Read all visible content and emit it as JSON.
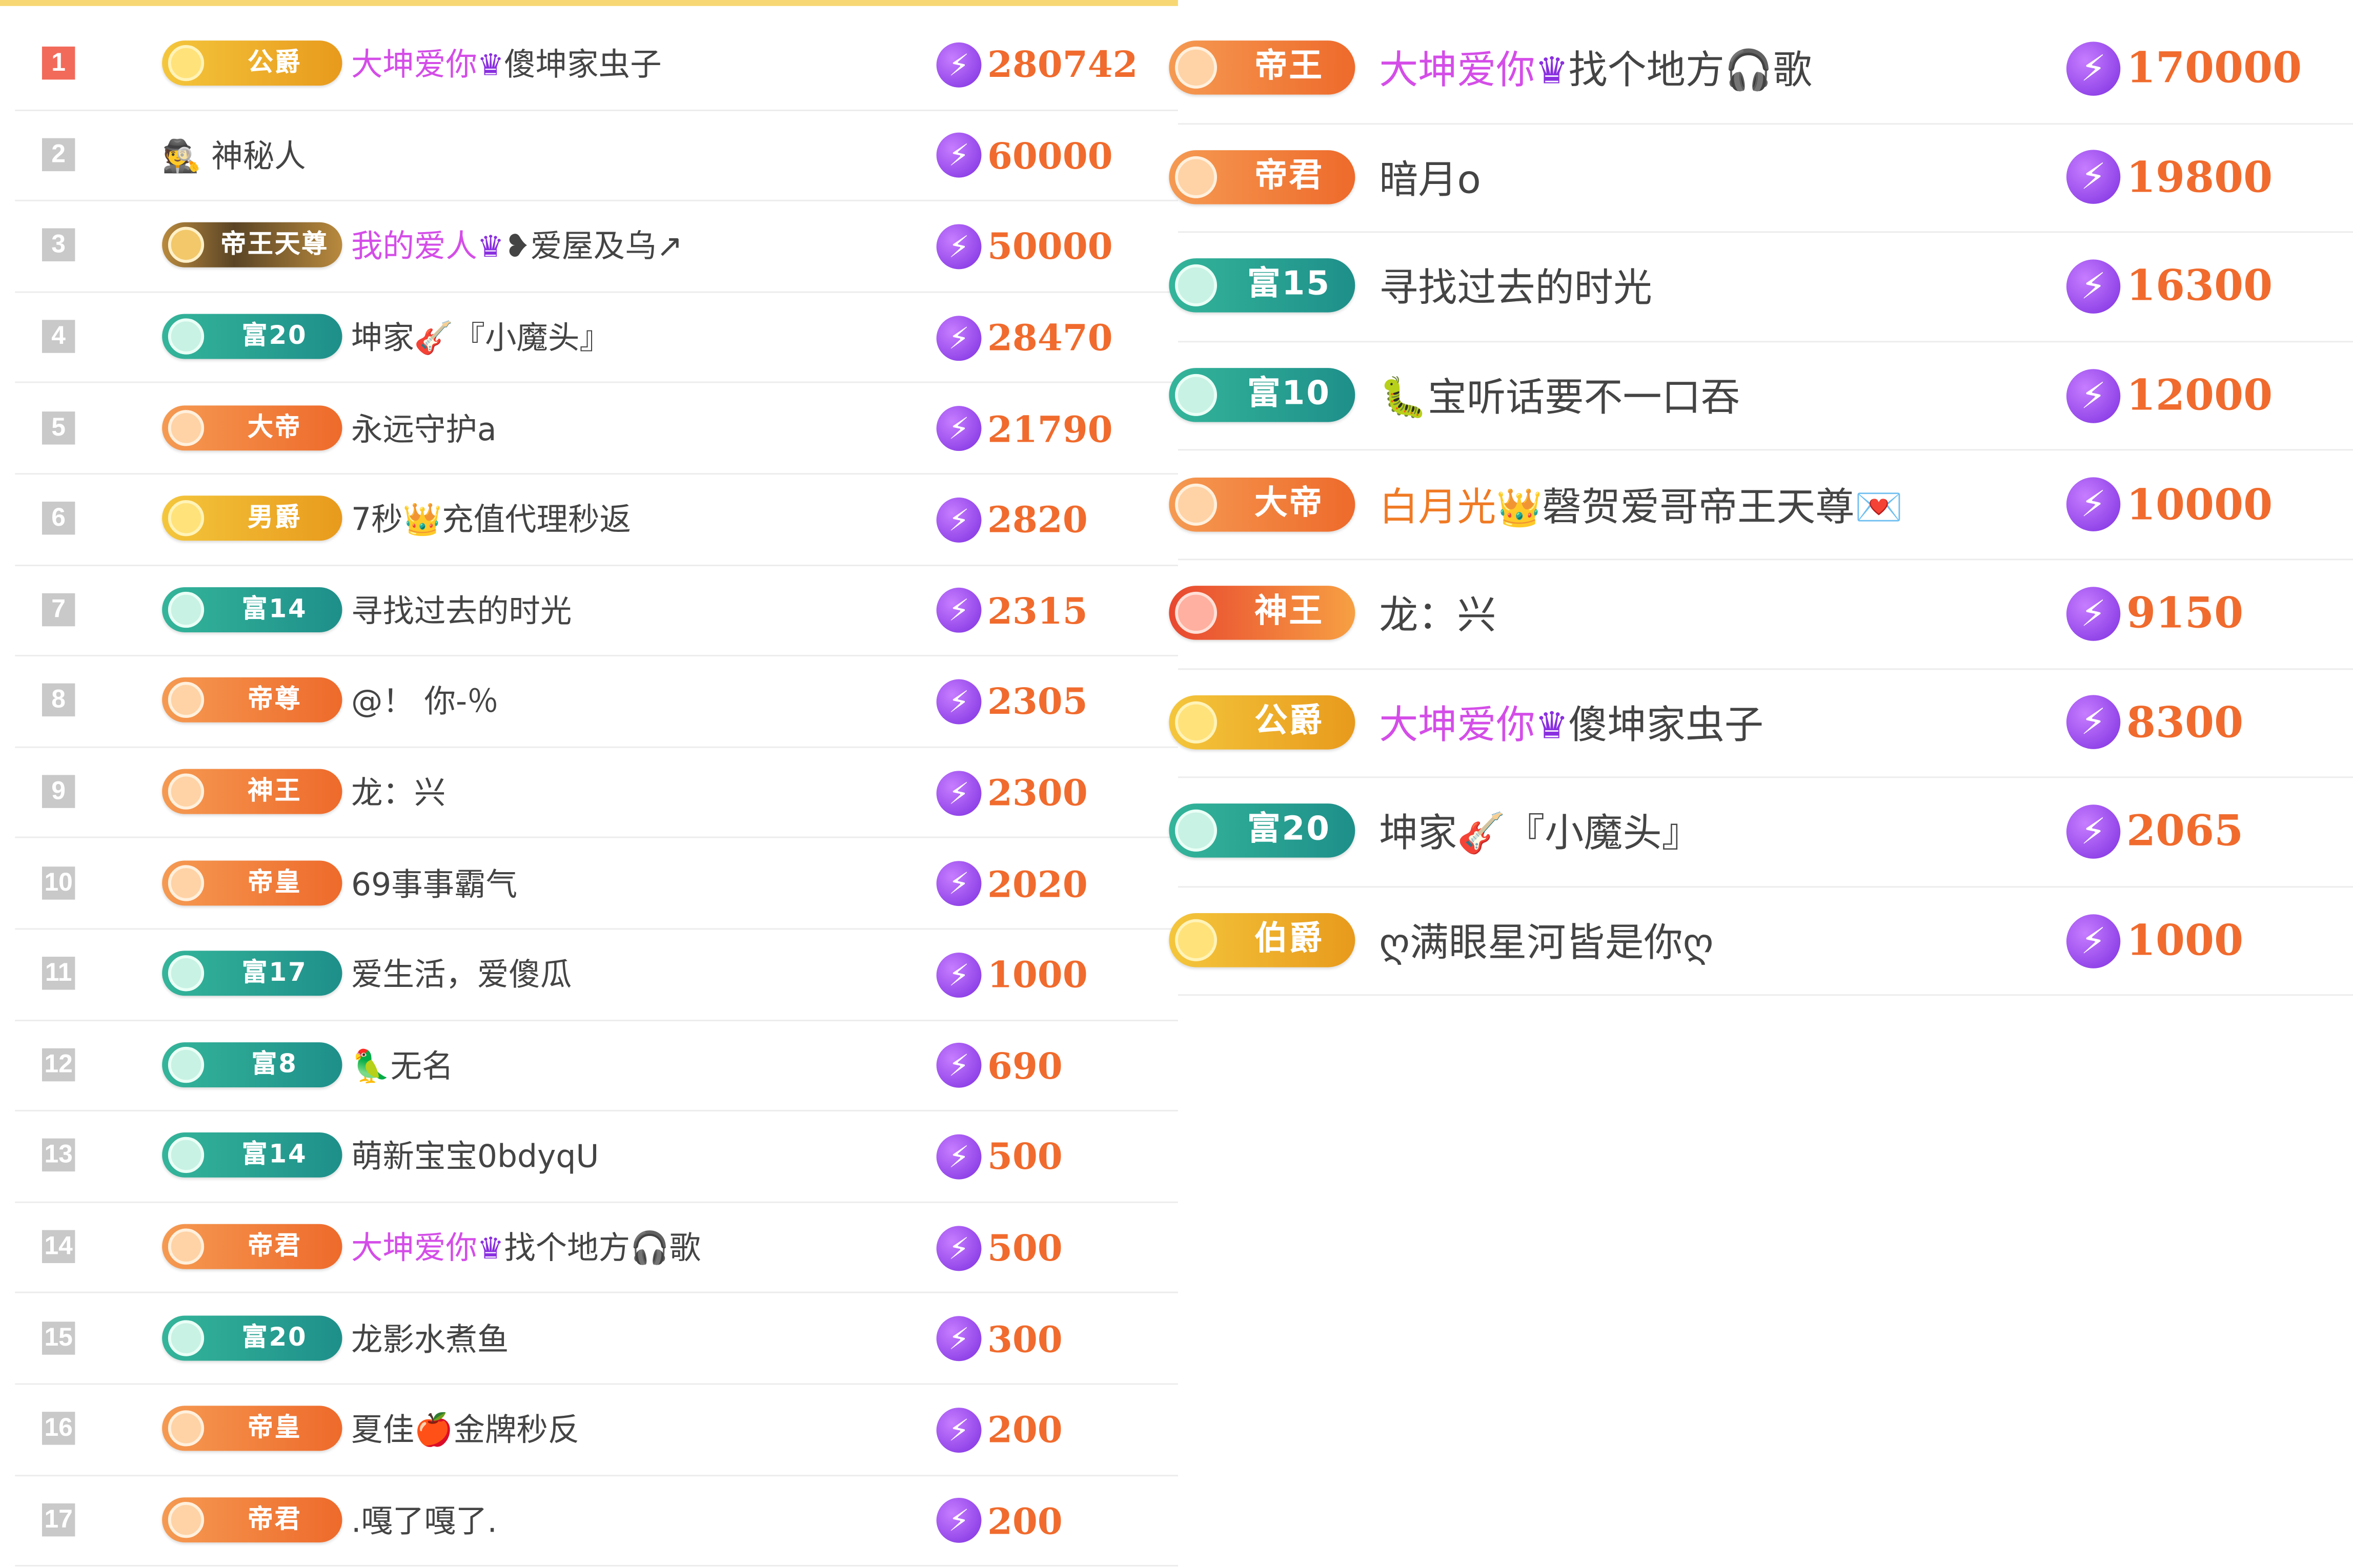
{
  "colors": {
    "accent": "#f7d774",
    "coin": "#f06b2d",
    "coin_icon": "#8a3ce8",
    "highlight_name": "#d44de8"
  },
  "icons": {
    "coin": "lightning-coin-icon",
    "crown": "purple-crown-icon",
    "headphones": "headphones-icon"
  },
  "left_list": [
    {
      "rank": "1",
      "badge": "公爵",
      "badge_style": "gold",
      "name_prefix": "大坤爱你",
      "crown": "♛",
      "name_suffix": "傻坤家虫子",
      "coins": "280742"
    },
    {
      "rank": "2",
      "badge": "",
      "badge_style": "none",
      "name_prefix": "",
      "crown": "",
      "name_suffix": "🕵 神秘人",
      "coins": "60000"
    },
    {
      "rank": "3",
      "badge": "帝王天尊",
      "badge_style": "dark",
      "name_prefix": "我的爱人",
      "crown": "♛",
      "name_suffix": "❥爱屋及乌↗",
      "coins": "50000"
    },
    {
      "rank": "4",
      "badge": "富20",
      "badge_style": "teal",
      "name_prefix": "",
      "crown": "",
      "name_suffix": "坤家🎸『小魔头』",
      "coins": "28470"
    },
    {
      "rank": "5",
      "badge": "大帝",
      "badge_style": "orange",
      "name_prefix": "",
      "crown": "",
      "name_suffix": "永远守护a",
      "coins": "21790"
    },
    {
      "rank": "6",
      "badge": "男爵",
      "badge_style": "gold",
      "name_prefix": "",
      "crown": "",
      "name_suffix": "7秒👑充值代理秒返",
      "coins": "2820"
    },
    {
      "rank": "7",
      "badge": "富14",
      "badge_style": "teal",
      "name_prefix": "",
      "crown": "",
      "name_suffix": "寻找过去的时光",
      "coins": "2315"
    },
    {
      "rank": "8",
      "badge": "帝尊",
      "badge_style": "orange",
      "name_prefix": "",
      "crown": "",
      "name_suffix": "@！ 你-％",
      "coins": "2305"
    },
    {
      "rank": "9",
      "badge": "神王",
      "badge_style": "orange",
      "name_prefix": "",
      "crown": "",
      "name_suffix": "龙：兴",
      "coins": "2300"
    },
    {
      "rank": "10",
      "badge": "帝皇",
      "badge_style": "orange",
      "name_prefix": "",
      "crown": "",
      "name_suffix": "69事事霸气",
      "coins": "2020"
    },
    {
      "rank": "11",
      "badge": "富17",
      "badge_style": "teal",
      "name_prefix": "",
      "crown": "",
      "name_suffix": "爱生活，爱傻瓜",
      "coins": "1000"
    },
    {
      "rank": "12",
      "badge": "富8",
      "badge_style": "teal",
      "name_prefix": "",
      "crown": "",
      "name_suffix": "🦜无名",
      "coins": "690"
    },
    {
      "rank": "13",
      "badge": "富14",
      "badge_style": "teal",
      "name_prefix": "",
      "crown": "",
      "name_suffix": "萌新宝宝0bdyqU",
      "coins": "500"
    },
    {
      "rank": "14",
      "badge": "帝君",
      "badge_style": "orange",
      "name_prefix": "大坤爱你",
      "crown": "♛",
      "name_suffix": "找个地方🎧歌",
      "coins": "500"
    },
    {
      "rank": "15",
      "badge": "富20",
      "badge_style": "teal",
      "name_prefix": "",
      "crown": "",
      "name_suffix": "龙影水煮鱼",
      "coins": "300"
    },
    {
      "rank": "16",
      "badge": "帝皇",
      "badge_style": "orange",
      "name_prefix": "",
      "crown": "",
      "name_suffix": "夏佳🍎金牌秒反",
      "coins": "200"
    },
    {
      "rank": "17",
      "badge": "帝君",
      "badge_style": "orange",
      "name_prefix": "",
      "crown": "",
      "name_suffix": ".嘎了嘎了.",
      "coins": "200"
    }
  ],
  "right_list": [
    {
      "badge": "帝王",
      "badge_style": "orange",
      "name_prefix": "大坤爱你",
      "crown": "♛",
      "name_suffix": "找个地方🎧歌",
      "coins": "170000"
    },
    {
      "badge": "帝君",
      "badge_style": "orange",
      "name_prefix": "",
      "crown": "",
      "name_suffix": "暗月o",
      "coins": "19800"
    },
    {
      "badge": "富15",
      "badge_style": "teal",
      "name_prefix": "",
      "crown": "",
      "name_suffix": "寻找过去的时光",
      "coins": "16300"
    },
    {
      "badge": "富10",
      "badge_style": "teal",
      "name_prefix": "",
      "crown": "",
      "name_suffix": "🐛宝听话要不一口吞",
      "coins": "12000"
    },
    {
      "badge": "大帝",
      "badge_style": "orange",
      "name_prefix": "白月光",
      "crown": "👑",
      "name_suffix": "磬贺爱哥帝王天尊💌",
      "coins": "10000"
    },
    {
      "badge": "神王",
      "badge_style": "red",
      "name_prefix": "",
      "crown": "",
      "name_suffix": "龙：兴",
      "coins": "9150"
    },
    {
      "badge": "公爵",
      "badge_style": "gold",
      "name_prefix": "大坤爱你",
      "crown": "♛",
      "name_suffix": "傻坤家虫子",
      "coins": "8300"
    },
    {
      "badge": "富20",
      "badge_style": "teal",
      "name_prefix": "",
      "crown": "",
      "name_suffix": "坤家🎸『小魔头』",
      "coins": "2065"
    },
    {
      "badge": "伯爵",
      "badge_style": "gold",
      "name_prefix": "",
      "crown": "",
      "name_suffix": "ღ满眼星河皆是你ღ",
      "coins": "1000"
    }
  ]
}
